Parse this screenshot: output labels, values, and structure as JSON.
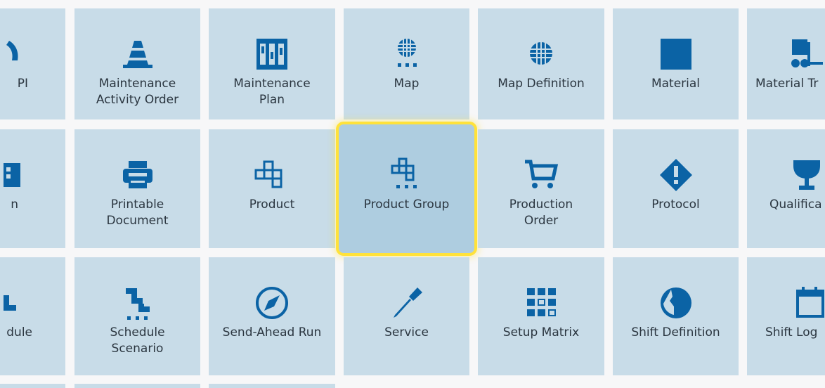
{
  "colors": {
    "tile_bg": "#c8dce8",
    "icon": "#0b63a5",
    "selected_outline": "#ffe23a",
    "selected_bg": "#aecde0"
  },
  "rows": [
    {
      "tiles": [
        {
          "label": "PI",
          "icon": "gauge-icon"
        },
        {
          "label": "Maintenance\nActivity Order",
          "icon": "traffic-cone-icon"
        },
        {
          "label": "Maintenance\nPlan",
          "icon": "maintenance-plan-icon"
        },
        {
          "label": "Map",
          "icon": "map-dots-icon"
        },
        {
          "label": "Map Definition",
          "icon": "globe-grid-icon"
        },
        {
          "label": "Material",
          "icon": "square-icon"
        },
        {
          "label": "Material Tr",
          "icon": "forklift-icon"
        }
      ]
    },
    {
      "tiles": [
        {
          "label": "n",
          "icon": "document-icon"
        },
        {
          "label": "Printable\nDocument",
          "icon": "printer-icon"
        },
        {
          "label": "Product",
          "icon": "product-blocks-icon"
        },
        {
          "label": "Product Group",
          "icon": "product-group-icon",
          "selected": true
        },
        {
          "label": "Production\nOrder",
          "icon": "cart-icon"
        },
        {
          "label": "Protocol",
          "icon": "diamond-alert-icon"
        },
        {
          "label": "Qualifica",
          "icon": "trophy-icon"
        }
      ]
    },
    {
      "tiles": [
        {
          "label": "dule",
          "icon": "schedule-icon"
        },
        {
          "label": "Schedule\nScenario",
          "icon": "schedule-scenario-icon"
        },
        {
          "label": "Send-Ahead Run",
          "icon": "compass-icon"
        },
        {
          "label": "Service",
          "icon": "screwdriver-icon"
        },
        {
          "label": "Setup Matrix",
          "icon": "matrix-icon"
        },
        {
          "label": "Shift Definition",
          "icon": "shift-clock-icon"
        },
        {
          "label": "Shift Log",
          "icon": "calendar-icon"
        }
      ]
    }
  ]
}
